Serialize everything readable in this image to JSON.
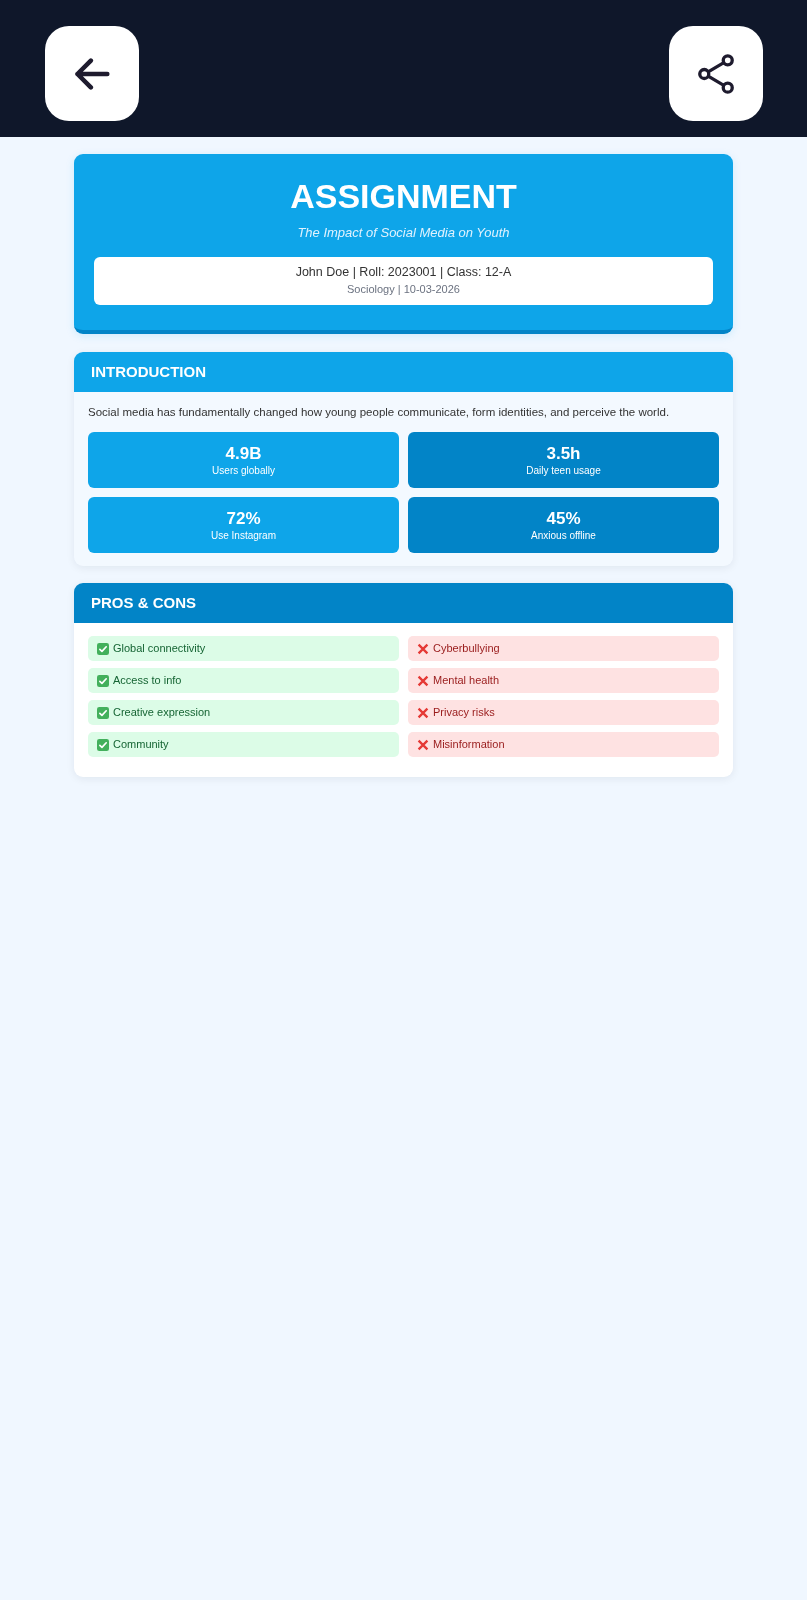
{
  "assignment": {
    "title": "ASSIGNMENT",
    "subtitle": "The Impact of Social Media on Youth",
    "info": {
      "student": "John Doe | Roll: 2023001 | Class: 12-A",
      "course": "Sociology | 10-03-2026"
    }
  },
  "introduction": {
    "heading": "INTRODUCTION",
    "text": "Social media has fundamentally changed how young people communicate, form identities, and perceive the world.",
    "stats": [
      {
        "value": "4.9B",
        "label": "Users globally",
        "color": "#0ea5e9"
      },
      {
        "value": "3.5h",
        "label": "Daily teen usage",
        "color": "#0284c7"
      },
      {
        "value": "72%",
        "label": "Use Instagram",
        "color": "#0ea5e9"
      },
      {
        "value": "45%",
        "label": "Anxious offline",
        "color": "#0284c7"
      }
    ]
  },
  "pros_cons": {
    "heading": "PROS & CONS",
    "items": [
      {
        "kind": "pro",
        "text": "Global connectivity"
      },
      {
        "kind": "con",
        "text": "Cyberbullying"
      },
      {
        "kind": "pro",
        "text": "Access to info"
      },
      {
        "kind": "con",
        "text": "Mental health"
      },
      {
        "kind": "pro",
        "text": "Creative expression"
      },
      {
        "kind": "con",
        "text": "Privacy risks"
      },
      {
        "kind": "pro",
        "text": "Community"
      },
      {
        "kind": "con",
        "text": "Misinformation"
      }
    ]
  }
}
